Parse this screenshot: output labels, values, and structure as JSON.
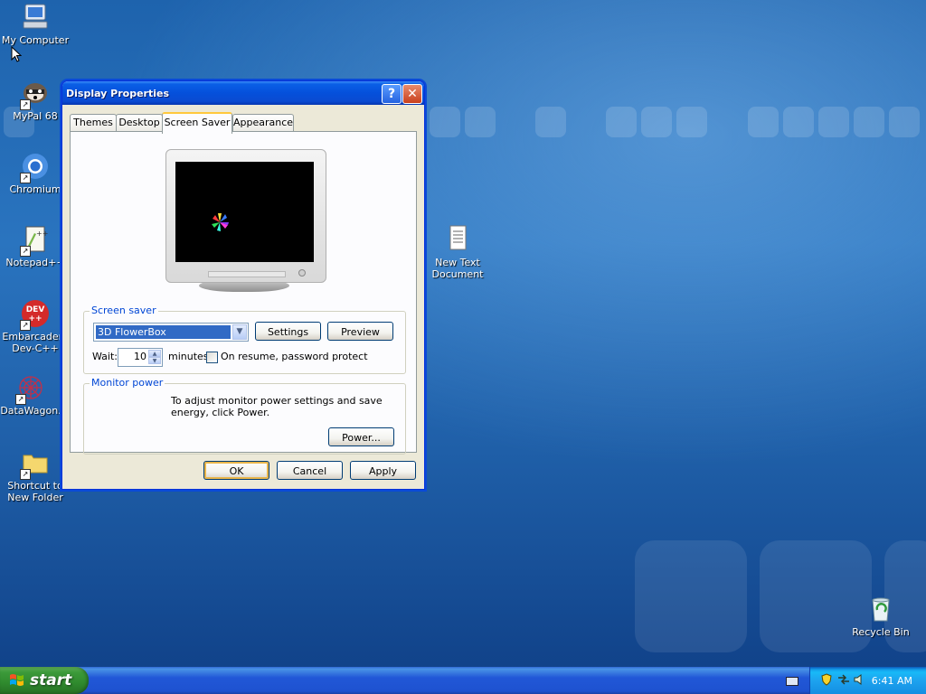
{
  "desktop": {
    "icons": [
      {
        "label": "My Computer",
        "icon": "my-computer-icon"
      },
      {
        "label": "MyPal 68",
        "icon": "mypal-icon"
      },
      {
        "label": "Chromium",
        "icon": "chromium-icon"
      },
      {
        "label": "Notepad++",
        "icon": "notepadpp-icon"
      },
      {
        "label": "Embarcadero\nDev-C++",
        "icon": "devcpp-icon"
      },
      {
        "label": "DataWagon.",
        "icon": "datawagon-icon"
      },
      {
        "label": "Shortcut to\nNew Folder",
        "icon": "folder-icon"
      },
      {
        "label": "New Text\nDocument",
        "icon": "text-document-icon"
      },
      {
        "label": "Recycle Bin",
        "icon": "recycle-bin-icon"
      }
    ],
    "embarcadero_short": "Embarcadero",
    "devcpp_line": "Dev-C++"
  },
  "dialog": {
    "title": "Display Properties",
    "help_glyph": "?",
    "close_glyph": "✕",
    "tabs": [
      "Themes",
      "Desktop",
      "Screen Saver",
      "Appearance"
    ],
    "active_tab": "Screen Saver",
    "screen_saver": {
      "group_label": "Screen saver",
      "selected": "3D FlowerBox",
      "settings_label": "Settings",
      "preview_label": "Preview",
      "wait_label": "Wait:",
      "wait_value": "10",
      "minutes_label": "minutes",
      "password_label": "On resume, password protect",
      "password_checked": false
    },
    "monitor_power": {
      "group_label": "Monitor power",
      "text": "To adjust monitor power settings and save energy, click Power.",
      "power_label": "Power..."
    },
    "buttons": {
      "ok": "OK",
      "cancel": "Cancel",
      "apply": "Apply"
    }
  },
  "taskbar": {
    "start_label": "start",
    "clock": "6:41 AM"
  },
  "colors": {
    "title_blue": "#0550db",
    "start_green": "#3c9a3a",
    "selection_blue": "#316ac5",
    "group_label_blue": "#0046d5"
  }
}
